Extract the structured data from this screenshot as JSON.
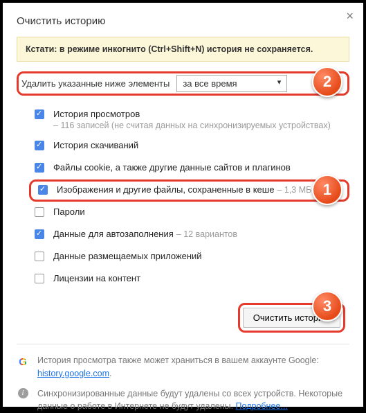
{
  "title": "Очистить историю",
  "notice": "Кстати: в режиме инкогнито (Ctrl+Shift+N) история не сохраняется.",
  "range": {
    "label": "Удалить указанные ниже элементы",
    "value": "за все время"
  },
  "items": [
    {
      "checked": true,
      "label": "История просмотров",
      "hint": "116 записей (не считая данных на синхронизируемых устройствах)",
      "multiline": true
    },
    {
      "checked": true,
      "label": "История скачиваний"
    },
    {
      "checked": true,
      "label": "Файлы cookie, а также другие данные сайтов и плагинов"
    },
    {
      "checked": true,
      "label": "Изображения и другие файлы, сохраненные в кеше",
      "hint": "1,3 МБ",
      "highlight": true
    },
    {
      "checked": false,
      "label": "Пароли"
    },
    {
      "checked": true,
      "label": "Данные для автозаполнения",
      "hint": "12 вариантов"
    },
    {
      "checked": false,
      "label": "Данные размещаемых приложений"
    },
    {
      "checked": false,
      "label": "Лицензии на контент"
    }
  ],
  "action": {
    "clear": "Очистить историю"
  },
  "footer": {
    "google_prefix": "История просмотра также может храниться в вашем аккаунте Google: ",
    "google_link": "history.google.com",
    "sync_text": "Синхронизированные данные будут удалены со всех устройств. Некоторые данные о работе в Интернете не будут удалены. ",
    "learn_more": "Подробнее..."
  },
  "badges": {
    "b1": "1",
    "b2": "2",
    "b3": "3"
  }
}
